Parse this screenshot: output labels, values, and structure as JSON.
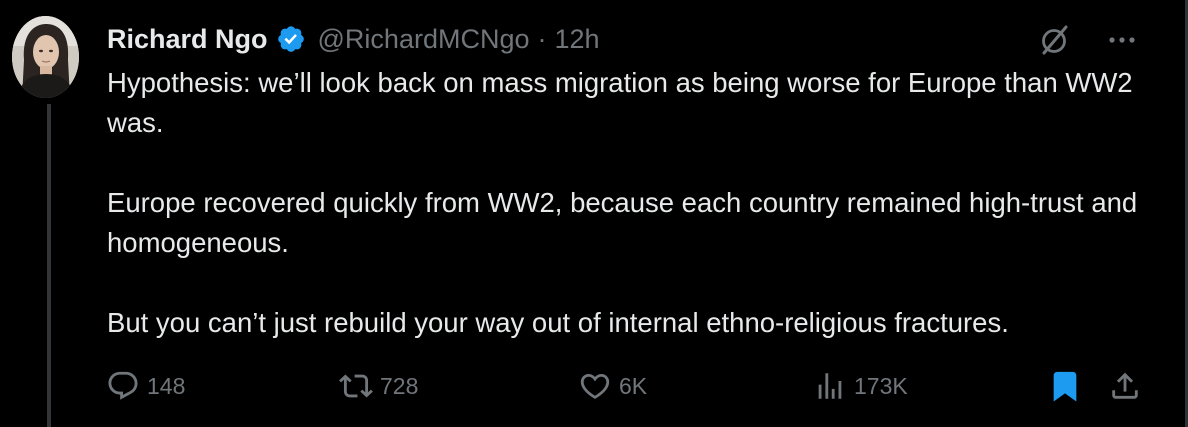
{
  "author": {
    "name": "Richard Ngo",
    "handle": "@RichardMCNgo",
    "separator": "·",
    "time": "12h",
    "verified": true
  },
  "tweet": {
    "paragraphs": [
      "Hypothesis: we’ll look back on mass migration as being worse for Europe than WW2 was.",
      "Europe recovered quickly from WW2, because each country remained high-trust and homogeneous.",
      "But you can’t just rebuild your way out of internal ethno-religious fractures."
    ]
  },
  "actions": {
    "replies": "148",
    "reposts": "728",
    "likes": "6K",
    "views": "173K",
    "bookmarked": true
  },
  "icons": {
    "reply": "reply-icon",
    "repost": "repost-icon",
    "like": "heart-icon",
    "views": "views-icon",
    "bookmark": "bookmark-icon",
    "share": "share-icon",
    "grok": "grok-icon",
    "more": "more-icon",
    "verified": "verified-badge-icon"
  },
  "colors": {
    "background": "#000000",
    "text": "#e7e9ea",
    "muted": "#71767b",
    "accent": "#1d9bf0",
    "thread_line": "#333639"
  }
}
